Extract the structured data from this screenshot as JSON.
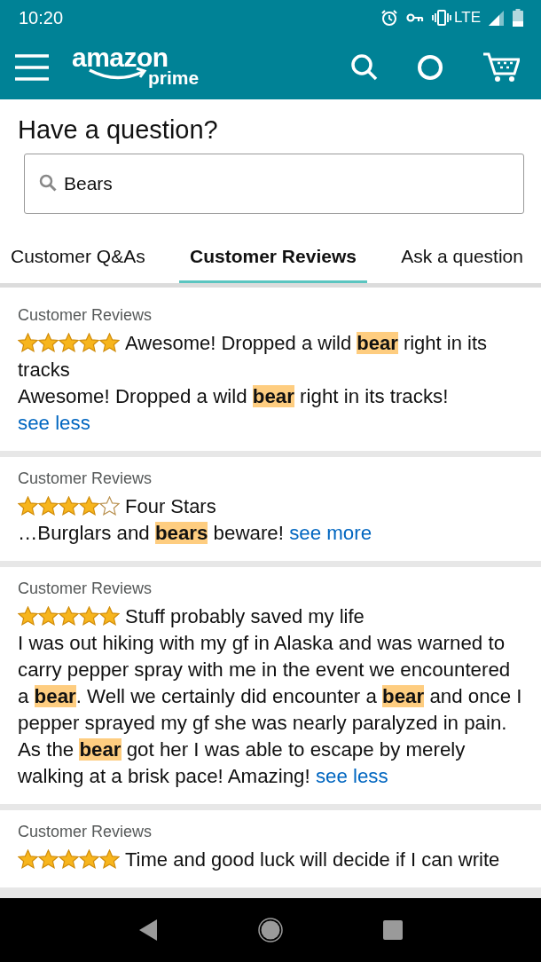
{
  "status_bar": {
    "time": "10:20",
    "network": "LTE"
  },
  "header": {
    "logo": "amazon",
    "logo_sub": "prime"
  },
  "question": {
    "title": "Have a question?",
    "search_value": "Bears"
  },
  "tabs": [
    {
      "label": "Customer Q&As",
      "selected": false
    },
    {
      "label": "Customer Reviews",
      "selected": true
    },
    {
      "label": "Ask a question",
      "selected": false
    }
  ],
  "reviews": [
    {
      "source": "Customer Reviews",
      "stars": 5,
      "title": "Awesome! Dropped a wild **bear** right in its tracks",
      "body": "Awesome! Dropped a wild **bear** right in its tracks!",
      "link": "see less"
    },
    {
      "source": "Customer Reviews",
      "stars": 4,
      "title": "Four Stars",
      "body": "…Burglars and **bears** beware!",
      "link": "see more"
    },
    {
      "source": "Customer Reviews",
      "stars": 5,
      "title": "Stuff probably saved my life",
      "body": "I was out hiking with my gf in Alaska and was warned to carry pepper spray with me in the event we encountered a **bear**. Well we certainly did encounter a **bear** and once I pepper sprayed my gf she was nearly paralyzed in pain. As the **bear** got her I was able to escape by merely walking at a brisk pace! Amazing!",
      "link": "see less"
    },
    {
      "source": "Customer Reviews",
      "stars": 5,
      "title": "Time and good luck will decide if I can write"
    }
  ]
}
